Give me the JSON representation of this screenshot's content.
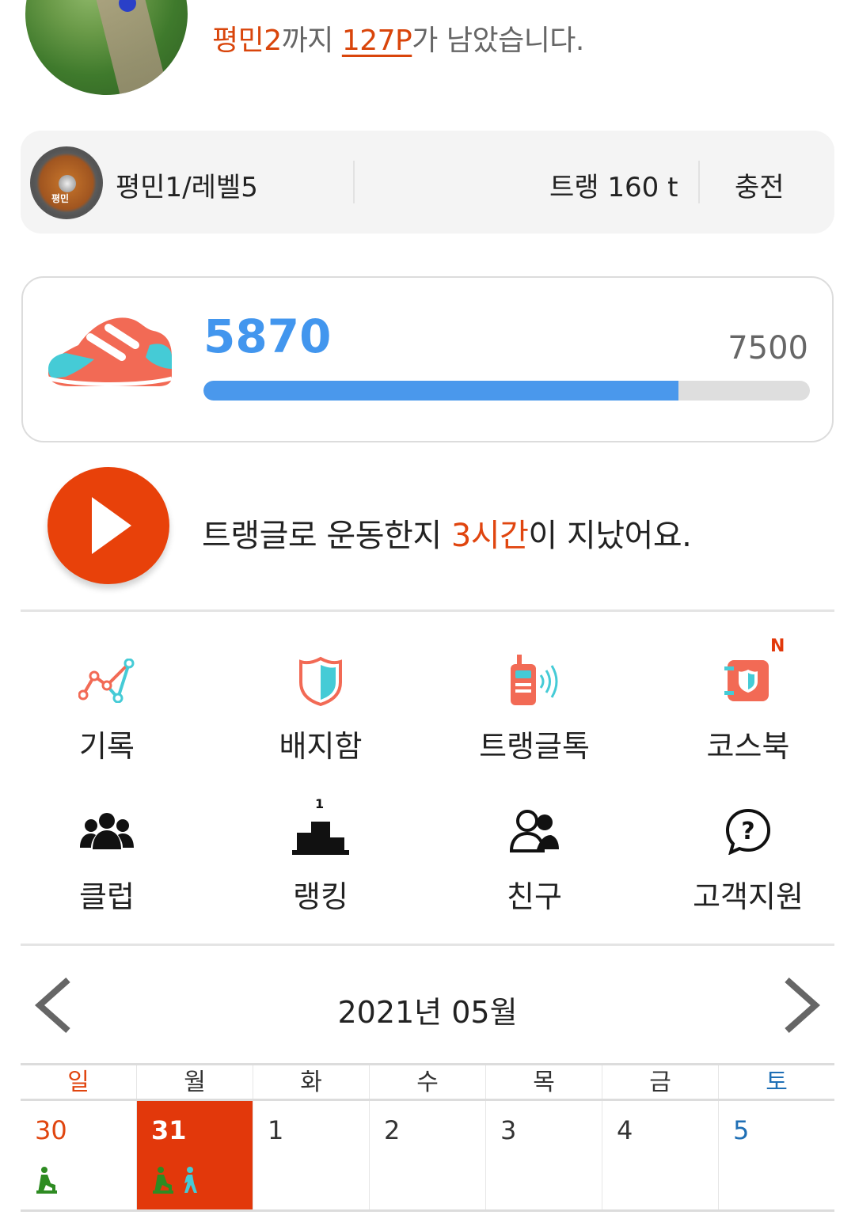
{
  "header": {
    "next_level": "평민2",
    "notice_mid": "까지 ",
    "points_left": "127P",
    "notice_end": "가 남았습니다."
  },
  "level": {
    "badge_text": "평민",
    "name": "평민1/레벨5",
    "points": "트랭 160 t",
    "charge_label": "충전"
  },
  "steps": {
    "current": "5870",
    "goal": "7500",
    "progress": 0.7827,
    "bar_color": "#4a98ec"
  },
  "activity": {
    "prefix": "트랭글로 운동한지 ",
    "duration": "3시간",
    "suffix": "이 지났어요."
  },
  "menu": [
    {
      "label": "기록",
      "icon": "chart-line-icon"
    },
    {
      "label": "배지함",
      "icon": "shield-badge-icon"
    },
    {
      "label": "트랭글톡",
      "icon": "walkie-talkie-icon"
    },
    {
      "label": "코스북",
      "icon": "coursebook-icon",
      "badge": "N"
    },
    {
      "label": "클럽",
      "icon": "group-icon"
    },
    {
      "label": "랭킹",
      "icon": "podium-icon",
      "rank": "1"
    },
    {
      "label": "친구",
      "icon": "friends-icon"
    },
    {
      "label": "고객지원",
      "icon": "help-icon"
    }
  ],
  "calendar": {
    "month": "2021년 05월",
    "weekdays": [
      "일",
      "월",
      "화",
      "수",
      "목",
      "금",
      "토"
    ],
    "days": [
      "30",
      "31",
      "1",
      "2",
      "3",
      "4",
      "5"
    ],
    "selected_index": 1,
    "accent": "#e2380b",
    "sunday_color": "#e0450f",
    "saturday_color": "#1f6fb5"
  }
}
